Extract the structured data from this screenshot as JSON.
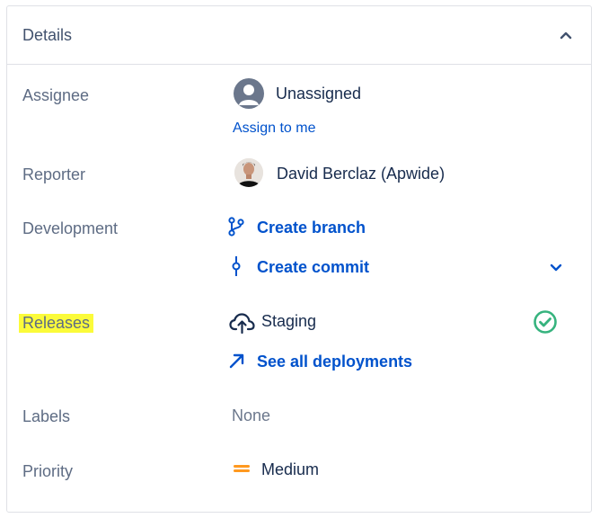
{
  "panel": {
    "title": "Details",
    "collapse_icon": "chevron-up-icon"
  },
  "fields": {
    "assignee": {
      "label": "Assignee",
      "value": "Unassigned",
      "action": "Assign to me"
    },
    "reporter": {
      "label": "Reporter",
      "value": "David Berclaz (Apwide)"
    },
    "development": {
      "label": "Development",
      "create_branch": "Create branch",
      "create_commit": "Create commit"
    },
    "releases": {
      "label": "Releases",
      "environment": "Staging",
      "see_all": "See all deployments"
    },
    "labels": {
      "label": "Labels",
      "value": "None"
    },
    "priority": {
      "label": "Priority",
      "value": "Medium"
    }
  },
  "colors": {
    "link": "#0052cc",
    "label": "#5e6c84",
    "success": "#36b37e",
    "priority_medium": "#ff991f",
    "highlight": "#fbfb3a"
  }
}
